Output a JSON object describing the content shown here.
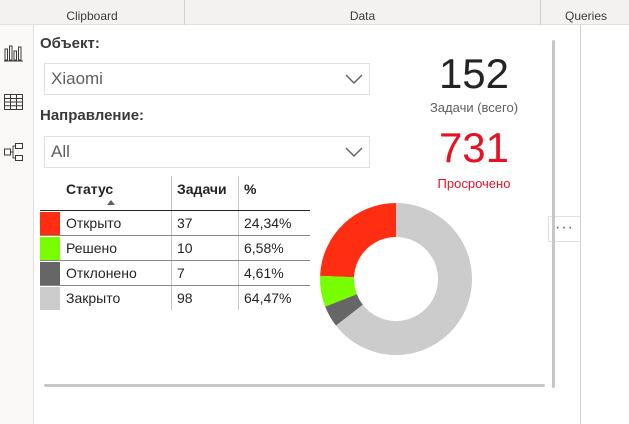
{
  "ribbon": {
    "groups": [
      "Clipboard",
      "Data",
      "Queries"
    ]
  },
  "rail": {
    "icons": [
      "report-view-icon",
      "table-view-icon",
      "model-view-icon"
    ]
  },
  "slicers": {
    "object": {
      "title": "Объект:",
      "value": "Xiaomi"
    },
    "direction": {
      "title": "Направление:",
      "value": "All"
    }
  },
  "cards": {
    "total": {
      "value": "152",
      "label": "Задачи (всего)",
      "color": "#252423"
    },
    "overdue": {
      "value": "731",
      "label": "Просрочено",
      "color": "#e81123"
    }
  },
  "table": {
    "headers": {
      "status": "Статус",
      "tasks": "Задачи",
      "pct": "%"
    },
    "rows": [
      {
        "status": "Открыто",
        "tasks": "37",
        "pct": "24,34%",
        "color": "#ff2e12"
      },
      {
        "status": "Решено",
        "tasks": "10",
        "pct": "6,58%",
        "color": "#77ff00"
      },
      {
        "status": "Отклонено",
        "tasks": "7",
        "pct": "4,61%",
        "color": "#666666"
      },
      {
        "status": "Закрыто",
        "tasks": "98",
        "pct": "64,47%",
        "color": "#cccccc"
      }
    ]
  },
  "more_options": "···",
  "chart_data": {
    "type": "pie",
    "donut": true,
    "categories": [
      "Открыто",
      "Решено",
      "Отклонено",
      "Закрыто"
    ],
    "values": [
      37,
      10,
      7,
      98
    ],
    "colors": [
      "#ff2e12",
      "#77ff00",
      "#666666",
      "#cccccc"
    ]
  }
}
